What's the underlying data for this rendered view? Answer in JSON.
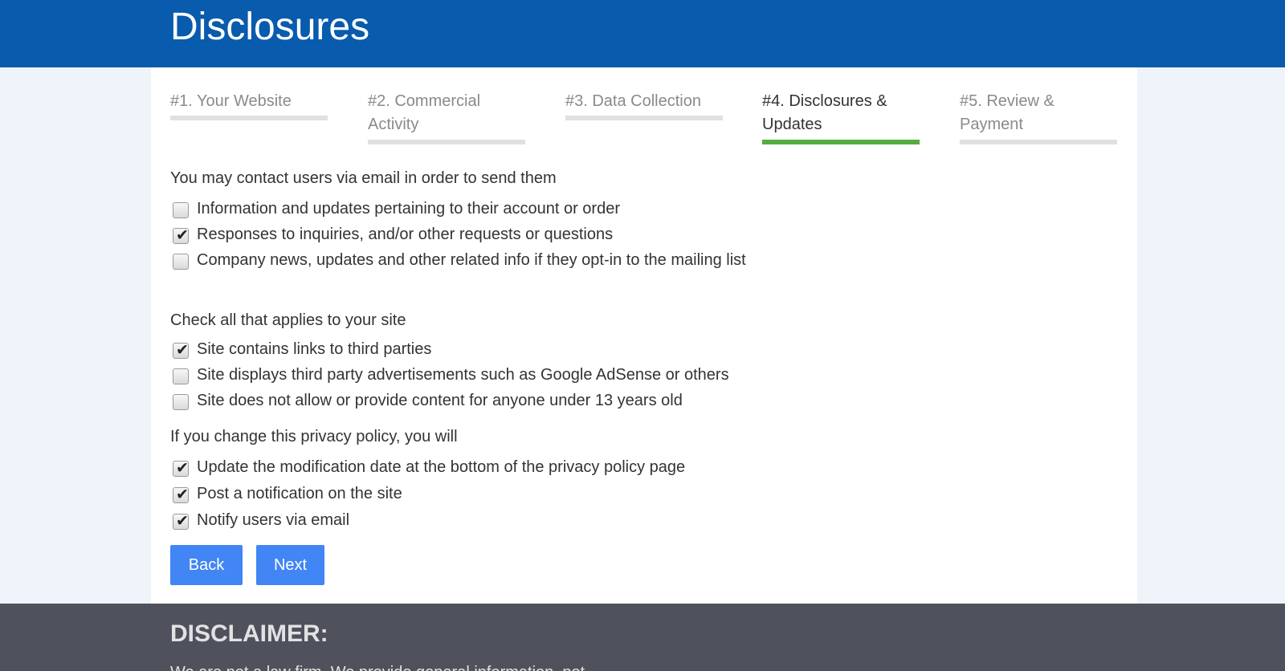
{
  "header": {
    "title": "Disclosures"
  },
  "steps": [
    {
      "label": "#1. Your Website",
      "active": false
    },
    {
      "label": "#2. Commercial Activity",
      "active": false
    },
    {
      "label": "#3. Data Collection",
      "active": false
    },
    {
      "label": "#4. Disclosures & Updates",
      "active": true
    },
    {
      "label": "#5. Review & Payment",
      "active": false
    }
  ],
  "contact": {
    "question": "You may contact users via email in order to send them",
    "options": [
      {
        "label": "Information and updates pertaining to their account or order",
        "checked": false
      },
      {
        "label": "Responses to inquiries, and/or other requests or questions",
        "checked": true
      },
      {
        "label": "Company news, updates and other related info if they opt-in to the mailing list",
        "checked": false
      }
    ]
  },
  "site": {
    "question": "Check all that applies to your site",
    "options": [
      {
        "label": "Site contains links to third parties",
        "checked": true
      },
      {
        "label": "Site displays third party advertisements such as Google AdSense or others",
        "checked": false
      },
      {
        "label": "Site does not allow or provide content for anyone under 13 years old",
        "checked": false
      }
    ]
  },
  "policy_change": {
    "question": "If you change this privacy policy, you will",
    "options": [
      {
        "label": "Update the modification date at the bottom of the privacy policy page",
        "checked": true
      },
      {
        "label": "Post a notification on the site",
        "checked": true
      },
      {
        "label": "Notify users via email",
        "checked": true
      }
    ]
  },
  "buttons": {
    "back": "Back",
    "next": "Next"
  },
  "footer": {
    "title": "DISCLAIMER:",
    "text": "We are not a law firm. We provide general information, not"
  },
  "colors": {
    "header_bg": "#085bad",
    "active_step": "#56ac3e",
    "button": "#4285f4",
    "footer_bg": "#4f525d"
  },
  "icons": {
    "checkmark": "check-icon"
  }
}
